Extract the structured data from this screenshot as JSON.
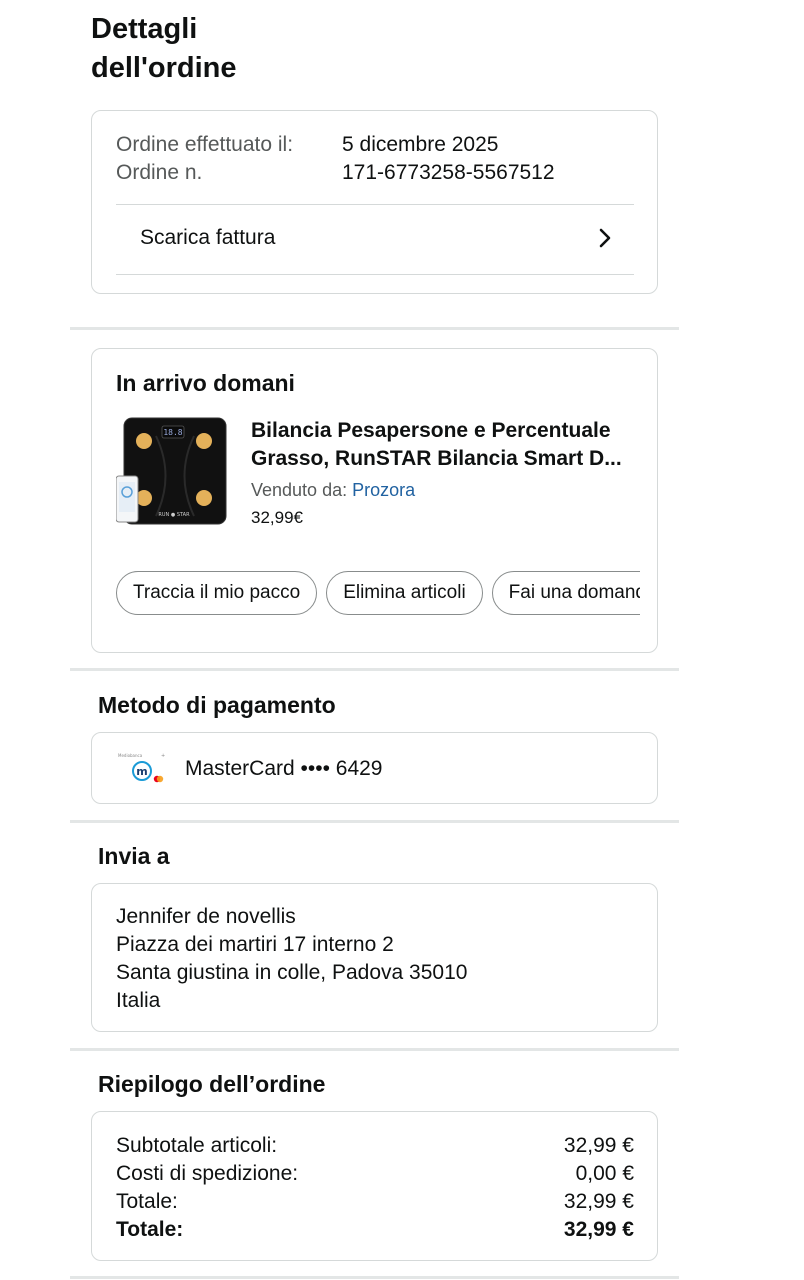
{
  "page_title": "Dettagli dell'ordine",
  "order_info": {
    "placed_label": "Ordine effettuato il:",
    "placed_value": "5 dicembre 2025",
    "number_label": "Ordine n.",
    "number_value": "171-6773258-5567512",
    "invoice_label": "Scarica fattura",
    "invoice_icon": "chevron-right-icon"
  },
  "shipment": {
    "title": "In arrivo domani",
    "product_image_icon": "smart-scale-image",
    "product_name_line1": "Bilancia Pesapersone e Percentuale",
    "product_name_line2": "Grasso, RunSTAR Bilancia Smart D...",
    "seller_label": "Venduto da:",
    "seller_name": "Prozora",
    "price": "32,99€",
    "actions": [
      "Traccia il mio pacco",
      "Elimina articoli",
      "Fai una domanda"
    ]
  },
  "payment": {
    "title": "Metodo di pagamento",
    "card_icon": "mastercard-icon",
    "card_label": "MasterCard •••• 6429"
  },
  "shipping": {
    "title": "Invia a",
    "name": "Jennifer de novellis",
    "street": "Piazza dei martiri 17 interno 2",
    "city": "Santa giustina in colle, Padova 35010",
    "country": "Italia"
  },
  "summary": {
    "title": "Riepilogo dell’ordine",
    "rows": [
      {
        "label": "Subtotale articoli:",
        "value": "32,99 €"
      },
      {
        "label": "Costi di spedizione:",
        "value": "0,00 €"
      },
      {
        "label": "Totale:",
        "value": "32,99 €"
      },
      {
        "label": "Totale:",
        "value": "32,99 €"
      }
    ]
  },
  "colors": {
    "link": "#2162a1",
    "border": "#d5d9d9",
    "muted_text": "#565959",
    "divider": "#e3e6e6"
  }
}
